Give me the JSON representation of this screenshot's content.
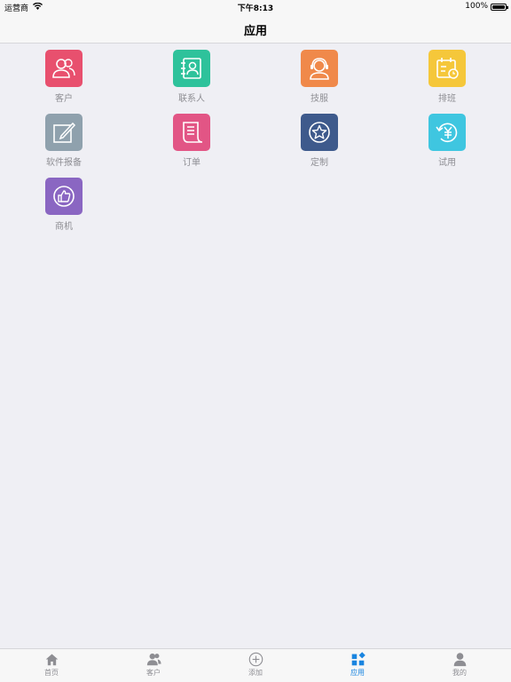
{
  "status_bar": {
    "carrier": "运营商",
    "time": "下午8:13",
    "battery": "100%"
  },
  "nav": {
    "title": "应用"
  },
  "apps": [
    {
      "label": "客户",
      "icon": "customers-icon",
      "color": "#e8506e"
    },
    {
      "label": "联系人",
      "icon": "contacts-icon",
      "color": "#2ec29b"
    },
    {
      "label": "技服",
      "icon": "support-headset-icon",
      "color": "#f0894a"
    },
    {
      "label": "排班",
      "icon": "schedule-calendar-icon",
      "color": "#f5c73a"
    },
    {
      "label": "软件报备",
      "icon": "edit-report-icon",
      "color": "#8fa1ad"
    },
    {
      "label": "订单",
      "icon": "order-receipt-icon",
      "color": "#e25585"
    },
    {
      "label": "定制",
      "icon": "star-badge-icon",
      "color": "#3e5a8c"
    },
    {
      "label": "试用",
      "icon": "trial-yuan-icon",
      "color": "#3fc6e0"
    },
    {
      "label": "商机",
      "icon": "thumbs-up-icon",
      "color": "#8a66c2"
    }
  ],
  "tabs": [
    {
      "label": "首页",
      "icon": "home-icon"
    },
    {
      "label": "客户",
      "icon": "customers-icon"
    },
    {
      "label": "添加",
      "icon": "add-circle-icon"
    },
    {
      "label": "应用",
      "icon": "apps-grid-icon",
      "active": true
    },
    {
      "label": "我的",
      "icon": "profile-icon"
    }
  ],
  "colors": {
    "accent": "#1a85e0",
    "background": "#efeff4",
    "label": "#8e8e93"
  }
}
